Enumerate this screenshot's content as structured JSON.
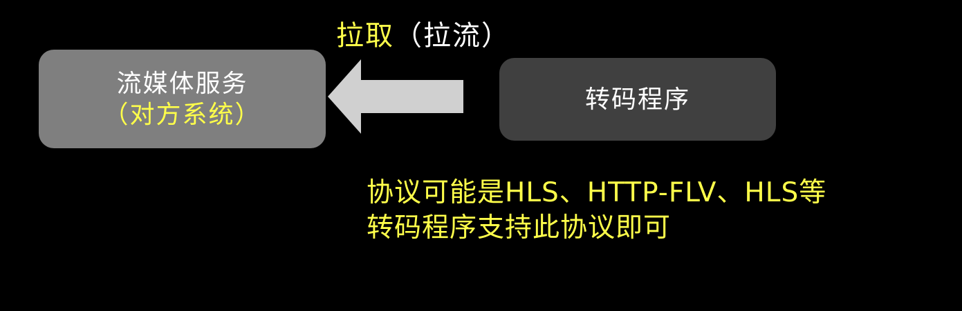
{
  "left_box": {
    "title": "流媒体服务",
    "subtitle": "（对方系统）"
  },
  "right_box": {
    "title": "转码程序"
  },
  "arrow_label": {
    "highlight": "拉取",
    "paren": "（拉流）"
  },
  "note": {
    "line1": "协议可能是HLS、HTTP-FLV、HLS等",
    "line2": "转码程序支持此协议即可"
  },
  "colors": {
    "background": "#000000",
    "left_box": "#7f7f7f",
    "right_box": "#404040",
    "arrow": "#d0d0d0",
    "highlight_text": "#ffff4a",
    "white_text": "#ffffff"
  }
}
